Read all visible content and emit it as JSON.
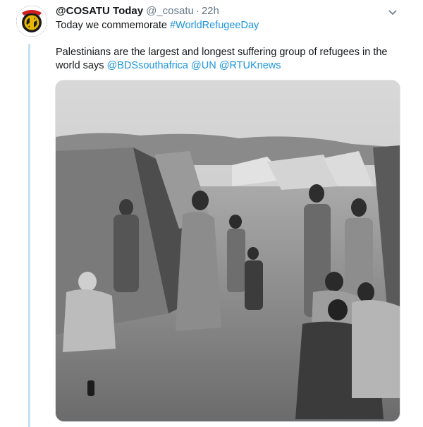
{
  "tweet": {
    "display_name": "@COSATU Today",
    "handle": "@_cosatu",
    "separator": "·",
    "time": "22h",
    "line1_text": "Today we commemorate ",
    "line1_hashtag": "#WorldRefugeeDay",
    "line2_text": "Palestinians are the largest and longest suffering group of refugees in the world says ",
    "mention1": "@BDSsouthafrica",
    "mention2": "@UN",
    "mention3": "@RTUKnews"
  },
  "icons": {
    "avatar": "cosatu-logo-icon",
    "menu": "chevron-down-icon"
  },
  "colors": {
    "link": "#1b95e0",
    "text": "#14171a",
    "muted": "#657786",
    "thread_line": "#c4e1f6"
  }
}
